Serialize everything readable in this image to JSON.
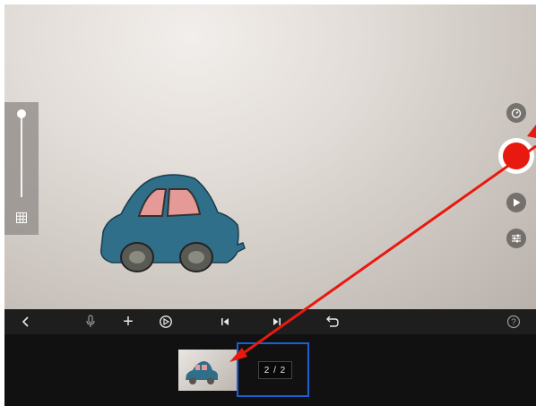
{
  "toolbar": {
    "back_icon": "chevron-left-icon",
    "mic_icon": "microphone-icon",
    "add_label": "+",
    "frame_count_label": "2 / 2",
    "help_label": "?"
  },
  "record": {
    "color": "#e8190f"
  },
  "colors": {
    "arrow": "#e8190f",
    "selection": "#1c5fd1",
    "toolbar_bg": "#1e1e1e"
  }
}
